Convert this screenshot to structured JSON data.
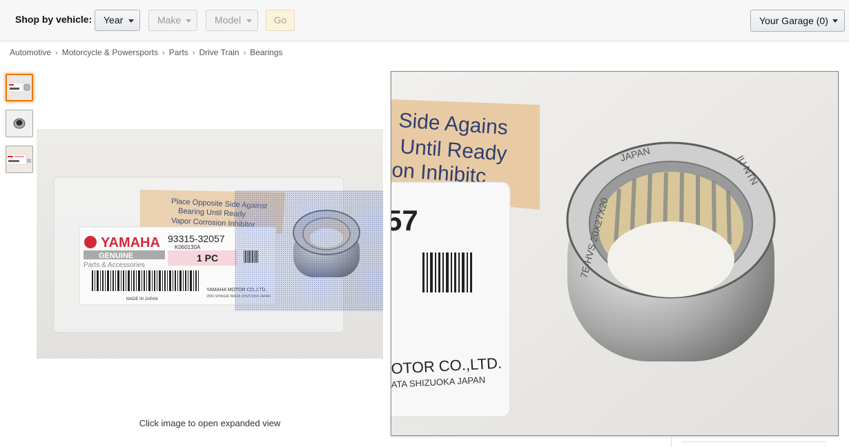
{
  "vehicle_bar": {
    "label": "Shop by vehicle:",
    "year": "Year",
    "make": "Make",
    "model": "Model",
    "go": "Go",
    "garage": "Your Garage (0)"
  },
  "breadcrumb": [
    "Automotive",
    "Motorcycle & Powersports",
    "Parts",
    "Drive Train",
    "Bearings"
  ],
  "product_image": {
    "brand": "YAMAHA",
    "genuine": "GENUINE",
    "parts_line": "Parts & Accessories",
    "part_number": "93315-32057",
    "lot_code": "K060130A",
    "quantity": "1 PC",
    "made_in": "MADE IN JAPAN",
    "maker": "YAMAHA MOTOR CO.,LTD.",
    "maker_address": "2500 SHINGAI IWATA SHIZUOKA JAPAN",
    "paper_lines": [
      "Place Opposite Side Against",
      "Bearing Until Ready",
      "Vapor Corrosion Inhibitor"
    ]
  },
  "zoom_image": {
    "paper_lines": [
      "Side Agains",
      "Until Ready",
      "on Inhibitc"
    ],
    "fragment": "57",
    "maker": "OTOR CO.,LTD.",
    "address": "ATA  SHIZUOKA  JAPAN",
    "ring_text_top": "JAPAN",
    "ring_text_right": "IU  NTN",
    "ring_text_left": "7E-HVS 20X27X20"
  },
  "hint": "Click image to open expanded view",
  "colors": {
    "thumb_selected": "#e77600",
    "go_bg": "#fbf3dd",
    "lens": "#5a78c8"
  }
}
